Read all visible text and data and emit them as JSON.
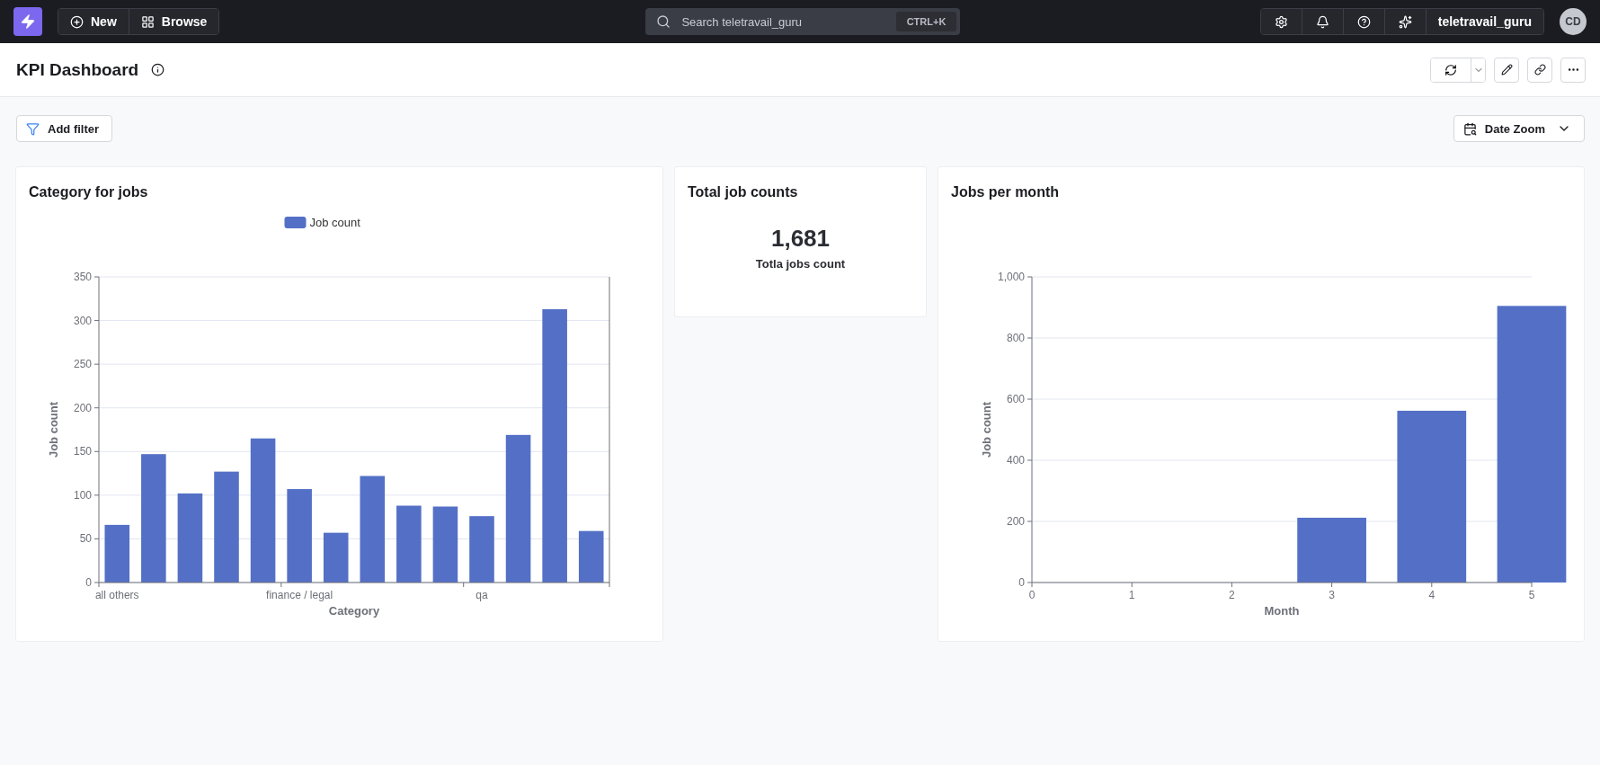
{
  "topbar": {
    "new_button": "New",
    "browse_button": "Browse",
    "search": {
      "placeholder": "Search teletravail_guru",
      "shortcut": "CTRL+K"
    },
    "user_button": "teletravail_guru",
    "avatar": "CD"
  },
  "header": {
    "title": "KPI Dashboard"
  },
  "toolbar": {
    "filter_button": "Add filter",
    "date_zoom": "Date Zoom"
  },
  "cards": [
    {
      "kind": "chart",
      "title": "Category for jobs",
      "legend": true,
      "chart_data": {
        "type": "bar",
        "xlabel": "Category",
        "ylabel": "Job count",
        "grid": true,
        "categories": [
          "all others",
          null,
          null,
          null,
          null,
          "finance / legal",
          null,
          null,
          null,
          null,
          "qa",
          null,
          null,
          null
        ],
        "series": [
          {
            "name": "Job count",
            "color": "#5470c6",
            "values": [
              66,
              147,
              102,
              127,
              165,
              107,
              57,
              122,
              88,
              87,
              76,
              169,
              313,
              59
            ]
          }
        ],
        "ylim": [
          0,
          350
        ],
        "yticks": [
          0,
          50,
          100,
          150,
          200,
          250,
          300,
          350
        ]
      }
    },
    {
      "kind": "number",
      "title": "Total job counts",
      "value": "1,681",
      "caption": "Totla jobs count"
    },
    {
      "kind": "chart",
      "title": "Jobs per month",
      "chart_data": {
        "type": "bar",
        "xlabel": "Month",
        "ylabel": "Job count",
        "grid": true,
        "x": [
          3,
          4,
          5
        ],
        "series": [
          {
            "color": "#5470c6",
            "values": [
              212,
              562,
              905
            ]
          }
        ],
        "xlim": [
          0,
          5
        ],
        "ylim": [
          0,
          1000
        ],
        "xticks": [
          0,
          1,
          2,
          3,
          4,
          5
        ],
        "yticks": [
          0,
          200,
          400,
          600,
          800,
          {
            "value": 1000,
            "label": "1,000"
          }
        ]
      }
    }
  ]
}
